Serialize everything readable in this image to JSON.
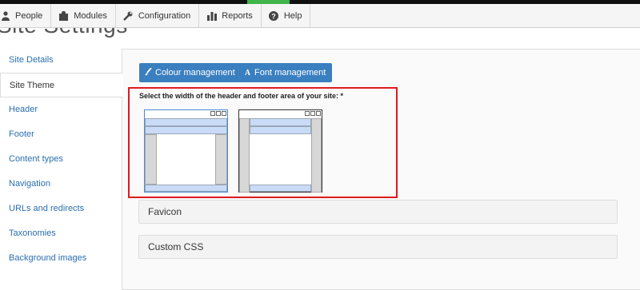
{
  "toolbar": {
    "items": [
      {
        "label": "People",
        "icon": "person-icon"
      },
      {
        "label": "Modules",
        "icon": "puzzle-icon"
      },
      {
        "label": "Configuration",
        "icon": "wrench-icon"
      },
      {
        "label": "Reports",
        "icon": "bar-chart-icon"
      },
      {
        "label": "Help",
        "icon": "question-icon"
      }
    ]
  },
  "page": {
    "title": "Site Settings"
  },
  "sidebar": {
    "items": [
      {
        "label": "Site Details"
      },
      {
        "label": "Site Theme"
      },
      {
        "label": "Header"
      },
      {
        "label": "Footer"
      },
      {
        "label": "Content types"
      },
      {
        "label": "Navigation"
      },
      {
        "label": "URLs and redirects"
      },
      {
        "label": "Taxonomies"
      },
      {
        "label": "Background images"
      }
    ],
    "active_index": 1
  },
  "main": {
    "buttons": {
      "colour": "Colour management",
      "font": "Font management"
    },
    "prompt": "Select the width of the header and footer area of your site: *",
    "layouts": [
      {
        "id": "full-width",
        "selected": true
      },
      {
        "id": "boxed",
        "selected": false
      }
    ],
    "panels": {
      "favicon": "Favicon",
      "custom_css": "Custom CSS"
    }
  },
  "colors": {
    "accent": "#3a7fc0",
    "highlight": "#e0191f",
    "toolbar_green": "#3fb54a"
  }
}
